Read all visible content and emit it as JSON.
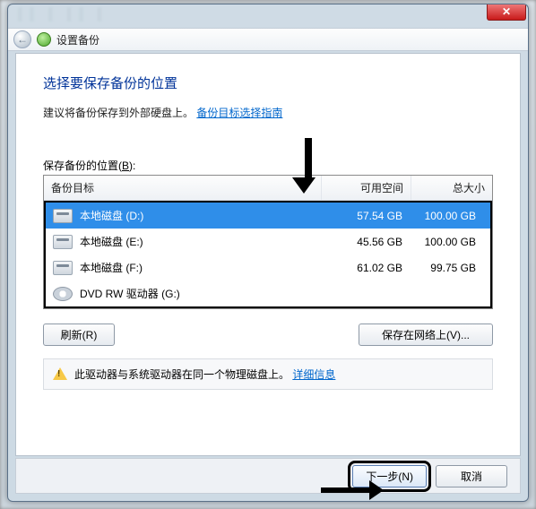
{
  "window": {
    "close_glyph": "✕",
    "back_glyph": "←",
    "wizard_title": "设置备份"
  },
  "page": {
    "heading": "选择要保存备份的位置",
    "advice_prefix": "建议将备份保存到外部硬盘上。",
    "advice_link": "备份目标选择指南",
    "location_label_pre": "保存备份的位置(",
    "location_label_key": "B",
    "location_label_post": "):"
  },
  "table": {
    "headers": {
      "target": "备份目标",
      "free": "可用空间",
      "total": "总大小"
    },
    "rows": [
      {
        "name": "本地磁盘 (D:)",
        "free": "57.54 GB",
        "total": "100.00 GB",
        "type": "hdd",
        "selected": true
      },
      {
        "name": "本地磁盘 (E:)",
        "free": "45.56 GB",
        "total": "100.00 GB",
        "type": "hdd",
        "selected": false
      },
      {
        "name": "本地磁盘 (F:)",
        "free": "61.02 GB",
        "total": "99.75 GB",
        "type": "hdd",
        "selected": false
      },
      {
        "name": "DVD RW 驱动器 (G:)",
        "free": "",
        "total": "",
        "type": "dvd",
        "selected": false
      }
    ]
  },
  "buttons": {
    "refresh": "刷新(R)",
    "network": "保存在网络上(V)...",
    "next": "下一步(N)",
    "cancel": "取消"
  },
  "warning": {
    "text": "此驱动器与系统驱动器在同一个物理磁盘上。",
    "link": "详细信息"
  }
}
